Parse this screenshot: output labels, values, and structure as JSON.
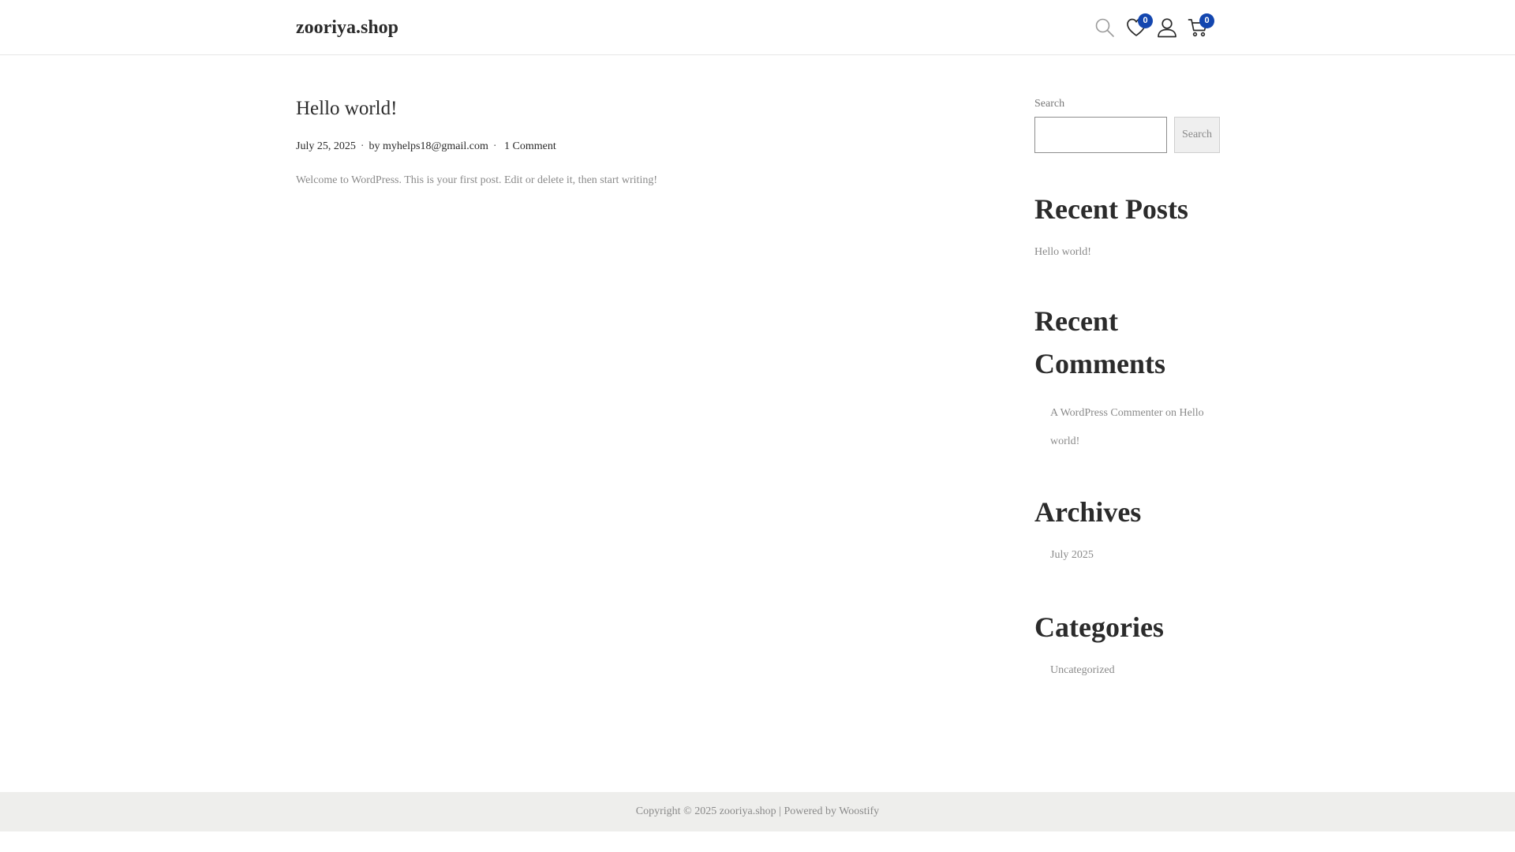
{
  "header": {
    "site_title": "zooriya.shop",
    "icons": [
      {
        "name": "search-icon"
      },
      {
        "name": "heart-icon",
        "badge": "0"
      },
      {
        "name": "user-icon"
      },
      {
        "name": "cart-icon",
        "badge": "0"
      }
    ],
    "accent_color": "#1346af"
  },
  "post": {
    "title": "Hello world!",
    "date": "July 25, 2025",
    "by_label": "by",
    "author": "myhelps18@gmail.com",
    "comments": "1 Comment",
    "excerpt": "Welcome to WordPress. This is your first post. Edit or delete it, then start writing!"
  },
  "sidebar": {
    "search": {
      "label": "Search",
      "value": "",
      "button_label": "Search"
    },
    "recent_posts": {
      "title": "Recent Posts",
      "items": [
        "Hello world!"
      ]
    },
    "recent_comments": {
      "title_line1": "Recent",
      "title_line2": "Comments",
      "items": [
        {
          "author": "A WordPress Commenter",
          "on_label": "on",
          "post": "Hello world!"
        }
      ]
    },
    "archives": {
      "title": "Archives",
      "items": [
        "July 2025"
      ]
    },
    "categories": {
      "title": "Categories",
      "items": [
        "Uncategorized"
      ]
    }
  },
  "footer": {
    "copyright": "Copyright © 2025 zooriya.shop",
    "separator": "|",
    "powered_label": "Powered by",
    "powered_link": "Woostify"
  }
}
